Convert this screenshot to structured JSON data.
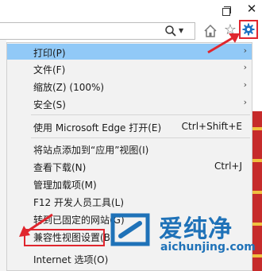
{
  "window": {
    "close_glyph": "✕"
  },
  "address_bar": {
    "dropdown_glyph": "▼"
  },
  "toolbar": {
    "star_glyph": "☆"
  },
  "menu": {
    "items": [
      {
        "label": "打印(P)",
        "shortcut": "",
        "submenu": true,
        "highlighted": true
      },
      {
        "label": "文件(F)",
        "shortcut": "",
        "submenu": true
      },
      {
        "label": "缩放(Z) (100%)",
        "shortcut": "",
        "submenu": true
      },
      {
        "label": "安全(S)",
        "shortcut": "",
        "submenu": true
      },
      {
        "label": "使用 Microsoft Edge 打开(E)",
        "shortcut": "Ctrl+Shift+E"
      },
      {
        "label": "将站点添加到“应用”视图(I)",
        "shortcut": ""
      },
      {
        "label": "查看下载(N)",
        "shortcut": "Ctrl+J"
      },
      {
        "label": "管理加载项(M)",
        "shortcut": ""
      },
      {
        "label": "F12 开发人员工具(L)",
        "shortcut": ""
      },
      {
        "label": "转到已固定的网站(G)",
        "shortcut": ""
      },
      {
        "label": "兼容性视图设置(B)",
        "shortcut": ""
      },
      {
        "label": "Internet 选项(O)",
        "shortcut": ""
      }
    ],
    "arrow_glyph": "›"
  },
  "watermark": {
    "brand_cn": "爱纯净",
    "brand_en": "aichunjing.com"
  },
  "colors": {
    "highlight": "#91c9f7",
    "annotation_red": "#e0262e",
    "watermark_blue": "#1f72b8"
  }
}
